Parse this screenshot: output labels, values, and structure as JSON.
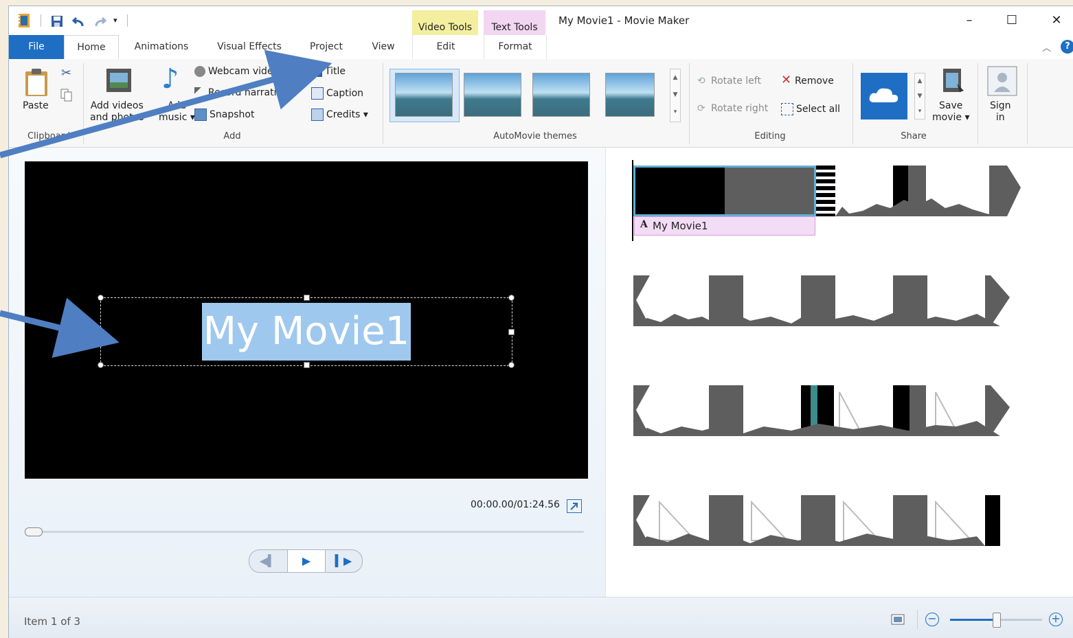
{
  "window": {
    "title": "My Movie1 - Movie Maker",
    "minimize": "–",
    "maximize": "☐",
    "close": "✕"
  },
  "context_tabs": {
    "video_tools": "Video Tools",
    "text_tools": "Text Tools"
  },
  "tabs": {
    "file": "File",
    "home": "Home",
    "animations": "Animations",
    "visual_effects": "Visual Effects",
    "project": "Project",
    "view": "View",
    "edit": "Edit",
    "format": "Format"
  },
  "ribbon": {
    "clipboard": {
      "paste": "Paste",
      "group": "Clipboard"
    },
    "add": {
      "add_videos": "Add videos",
      "add_videos_line2": "and photos",
      "add_music": "Add",
      "add_music_line2": "music",
      "webcam": "Webcam video",
      "narration": "Record narration",
      "snapshot": "Snapshot",
      "title": "Title",
      "caption": "Caption",
      "credits": "Credits",
      "group": "Add"
    },
    "themes": {
      "group": "AutoMovie themes"
    },
    "editing": {
      "rotate_left": "Rotate left",
      "rotate_right": "Rotate right",
      "remove": "Remove",
      "select_all": "Select all",
      "group": "Editing"
    },
    "share": {
      "save_movie": "Save",
      "save_movie_line2": "movie",
      "sign_in": "Sign",
      "sign_in_line2": "in",
      "group": "Share"
    }
  },
  "preview": {
    "title_text": "My Movie1",
    "timecode": "00:00.00/01:24.56",
    "seek_position": 0.0
  },
  "storyboard": {
    "caption_label": "My Movie1",
    "rows": 4
  },
  "status": {
    "item_text": "Item 1 of 3",
    "zoom_level": 0.5
  },
  "colors": {
    "accent": "#1e6fc4",
    "context_video_tools": "#f3ef9e",
    "context_text_tools": "#f2d6f2",
    "title_highlight": "#9fc8ee",
    "annotation_arrow": "#4f7fc2"
  }
}
